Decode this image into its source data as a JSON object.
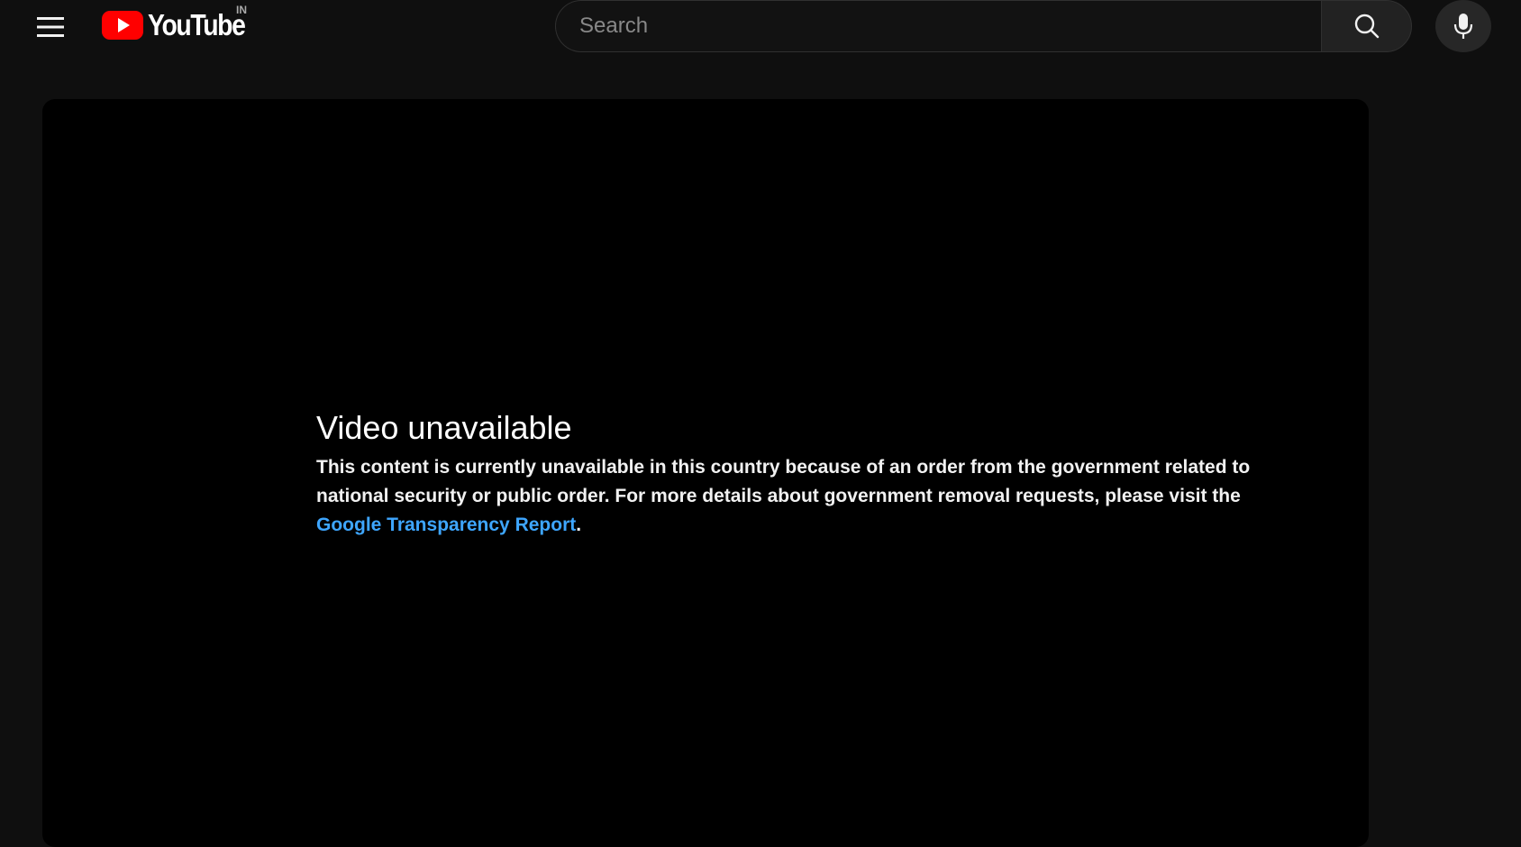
{
  "masthead": {
    "logo_text": "YouTube",
    "country_code": "IN",
    "search": {
      "placeholder": "Search",
      "value": ""
    },
    "icons": {
      "menu": "hamburger-menu-icon",
      "search": "search-icon",
      "mic": "microphone-icon"
    }
  },
  "player": {
    "error": {
      "title": "Video unavailable",
      "message": "This content is currently unavailable in this country because of an order from the government related to national security or public order. For more details about government removal requests, please visit the ",
      "link_text": "Google Transparency Report",
      "suffix": "."
    }
  },
  "colors": {
    "background": "#0f0f0f",
    "player_background": "#000000",
    "brand_red": "#ff0000",
    "link": "#3ea6ff"
  }
}
